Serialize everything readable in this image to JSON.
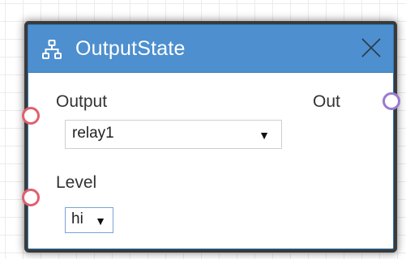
{
  "node": {
    "title": "OutputState",
    "icon": "hierarchy-icon",
    "header_color": "#4d8fcf",
    "fields": {
      "output": {
        "label": "Output",
        "selected": "relay1"
      },
      "level": {
        "label": "Level",
        "selected": "hi"
      }
    },
    "outputs": {
      "out_label": "Out"
    },
    "ports": {
      "input_color": "#e0606e",
      "output_color": "#9a7bd0"
    }
  }
}
